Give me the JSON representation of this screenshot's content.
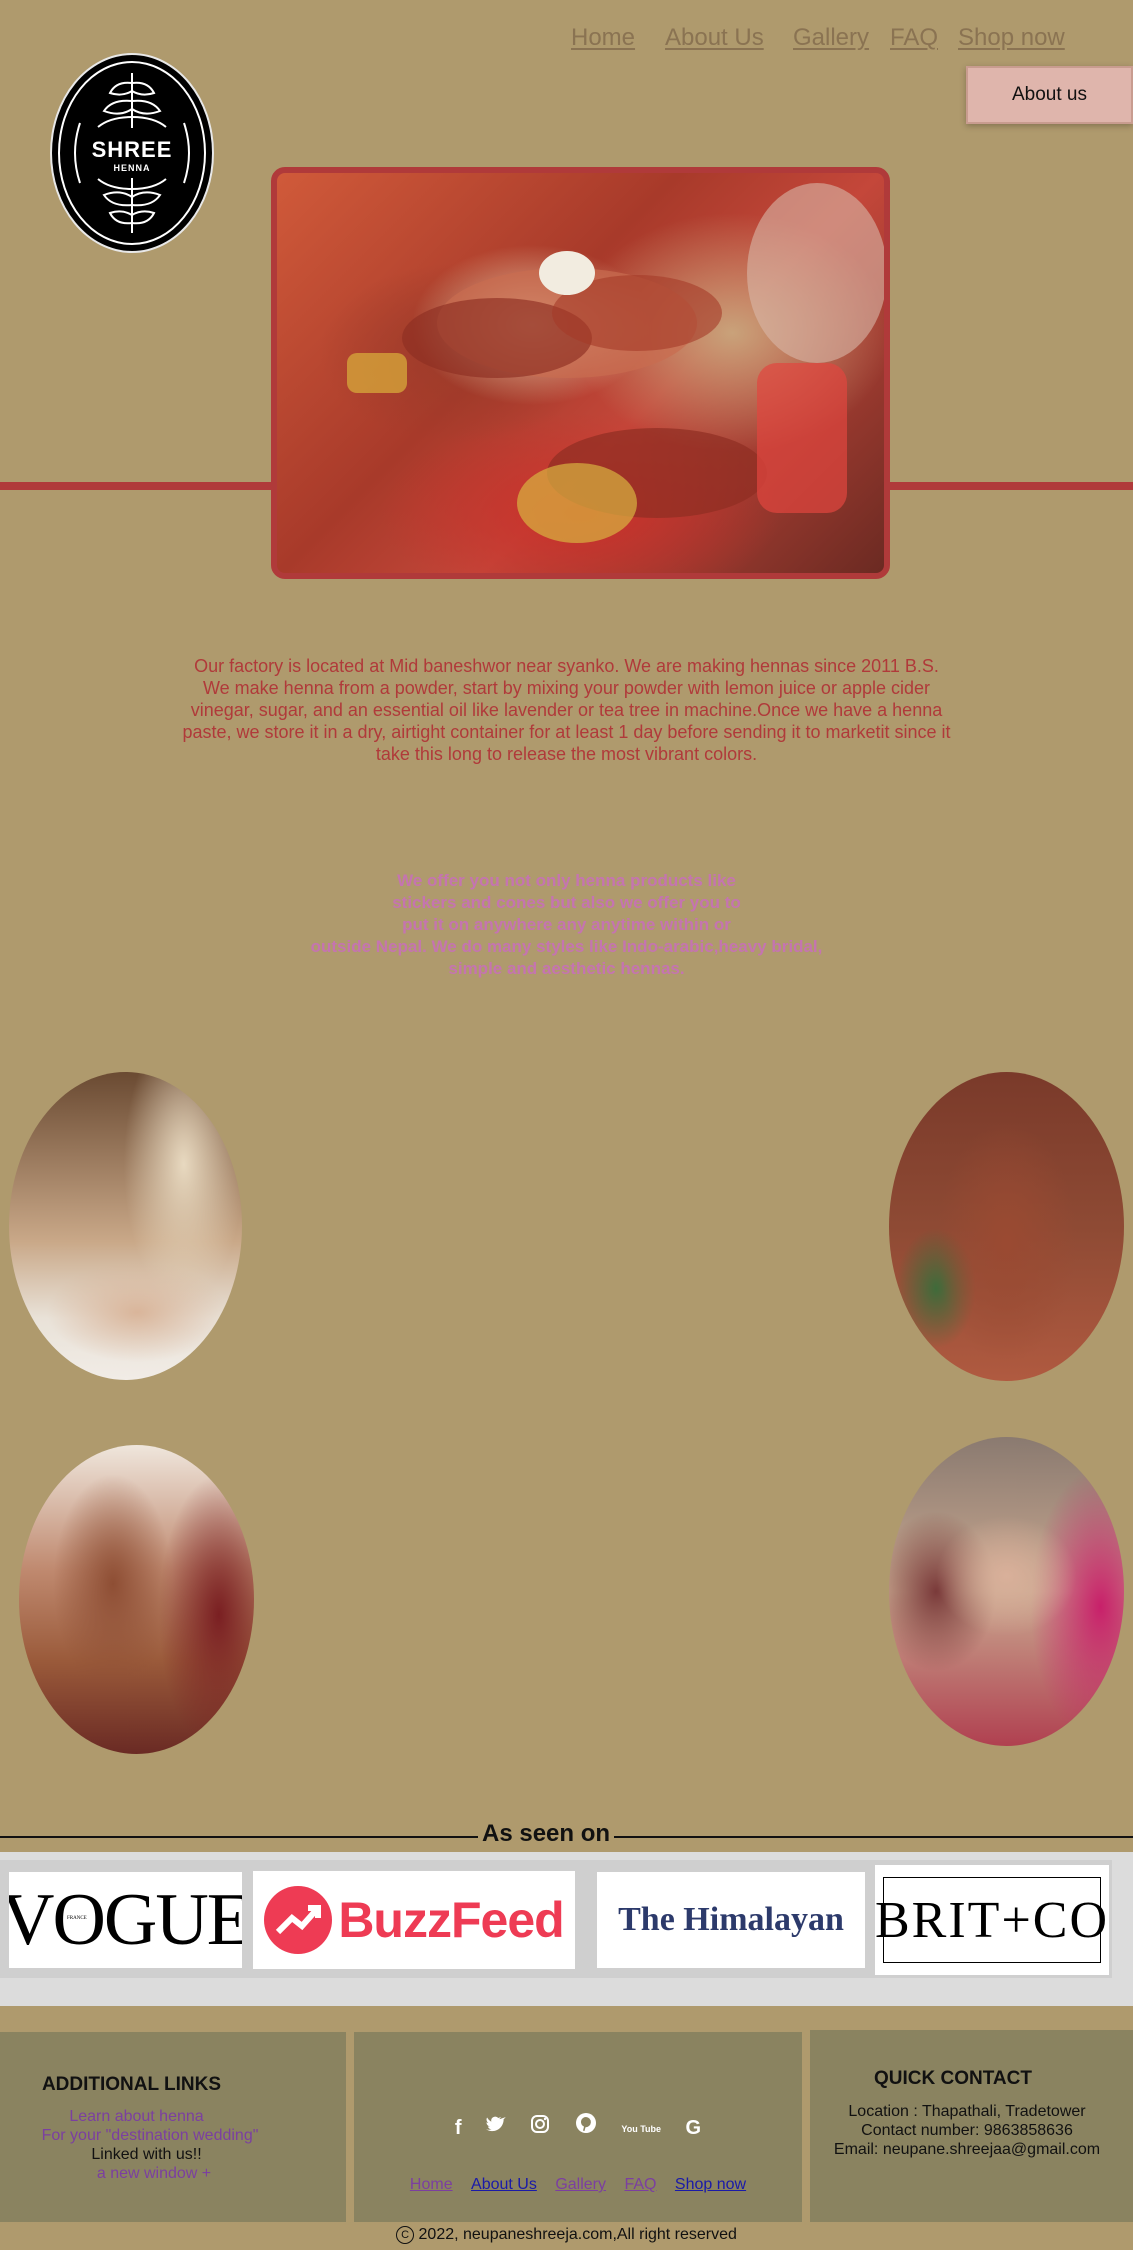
{
  "nav": {
    "home": "Home",
    "about": "About Us",
    "gallery": "Gallery",
    "faq": "FAQ",
    "shop": "Shop now",
    "about_button": "About us"
  },
  "logo": {
    "title": "SHREE",
    "subtitle": "HENNA"
  },
  "intro": {
    "paragraph": "Our factory is located at Mid baneshwor near syanko. We are making hennas since 2011 B.S. We make henna from a powder, start by mixing your powder with lemon juice or apple cider vinegar, sugar, and an essential oil like lavender or tea tree in machine.Once we have a henna paste, we store it in a dry, airtight container for at least 1 day before sending it to marketit since it take this long to release the most vibrant colors."
  },
  "services": {
    "line1": "We offer you not only henna products like",
    "line2": "stickers and cones but also we offer you to",
    "line3": "put it on anywhere any anytime within or",
    "line4": "outside Nepal. We do many styles like Indo-arabic,heavy bridal,",
    "line5": "simple and aesthetic hennas."
  },
  "seen_on": {
    "title": "As seen on",
    "brands": {
      "vogue": "VOGUE",
      "vogue_small": "FRANCE",
      "buzzfeed": "BuzzFeed",
      "himalayan": "The Himalayan",
      "britco": "BRIT+CO"
    }
  },
  "footer": {
    "additional": {
      "heading": "ADDITIONAL LINKS",
      "link1": "Learn about henna",
      "link2": "For your \"destination wedding\"",
      "link3": "Linked with us!!",
      "link4": "a new window +"
    },
    "icons": {
      "facebook": "f",
      "twitter": "🐦",
      "instagram": "◎",
      "pinterest": "℗",
      "youtube": "You Tube",
      "google": "G"
    },
    "nav": {
      "home": "Home",
      "about": "About Us",
      "gallery": "Gallery",
      "faq": "FAQ",
      "shop": "Shop now"
    },
    "contact": {
      "heading": "QUICK CONTACT",
      "location": "Location :  Thapathali, Tradetower",
      "phone": "Contact number: 9863858636",
      "email": "Email: neupane.shreejaa@gmail.com"
    },
    "copyright": "2022, neupaneshreeja.com,All right reserved"
  },
  "colors": {
    "background": "#af9a6d",
    "accent_red": "#b03a3a",
    "purple_text": "#c574b0",
    "footer_box": "#8a8360"
  }
}
